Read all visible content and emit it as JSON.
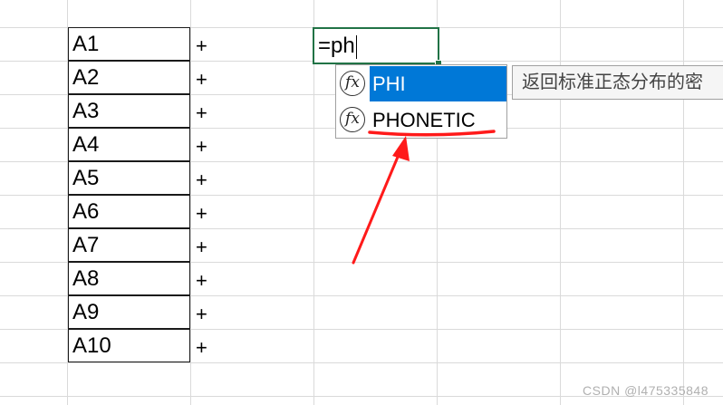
{
  "cells": [
    "A1",
    "A2",
    "A3",
    "A4",
    "A5",
    "A6",
    "A7",
    "A8",
    "A9",
    "A10"
  ],
  "plus": "+",
  "editor": {
    "text": "=ph"
  },
  "autocomplete": {
    "icon_glyph": "fx",
    "items": [
      {
        "label": "PHI",
        "selected": true
      },
      {
        "label": "PHONETIC",
        "selected": false
      }
    ],
    "selected_color": "#0078d7"
  },
  "tooltip": {
    "text": "返回标准正态分布的密"
  },
  "annotation": {
    "color": "#ff1a1a"
  },
  "watermark": "CSDN @l475335848"
}
